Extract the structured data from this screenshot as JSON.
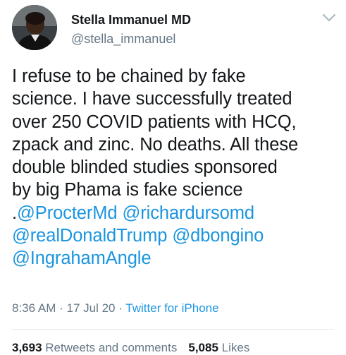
{
  "author": {
    "display_name": "Stella Immanuel MD",
    "handle": "@stella_immanuel"
  },
  "tweet": {
    "lines": [
      "I refuse to be chained by fake",
      "science. I have successfully treated",
      "over 250 COVID patients with HCQ,",
      "zpack and zinc. No deaths. All these",
      "double blinded studies sponsored",
      "by big Phama is fake science"
    ],
    "mention_prefix": ".",
    "mentions": {
      "procter": "@ProcterMd",
      "richard": "@richardursomd",
      "trump": "@realDonaldTrump",
      "bongino": "@dbongino",
      "ingraham": "@IngrahamAngle"
    }
  },
  "meta": {
    "time": "8:36 AM",
    "separator": " · ",
    "date": "17 Jul 20",
    "source": "Twitter for iPhone"
  },
  "stats": {
    "retweets_count": "3,693",
    "retweets_label": "Retweets and comments",
    "likes_count": "5,085",
    "likes_label": "Likes"
  },
  "icons": {
    "menu": "chevron-down-icon"
  },
  "colors": {
    "link": "#1b95e0",
    "secondary_text": "#657786",
    "primary_text": "#14171a"
  }
}
